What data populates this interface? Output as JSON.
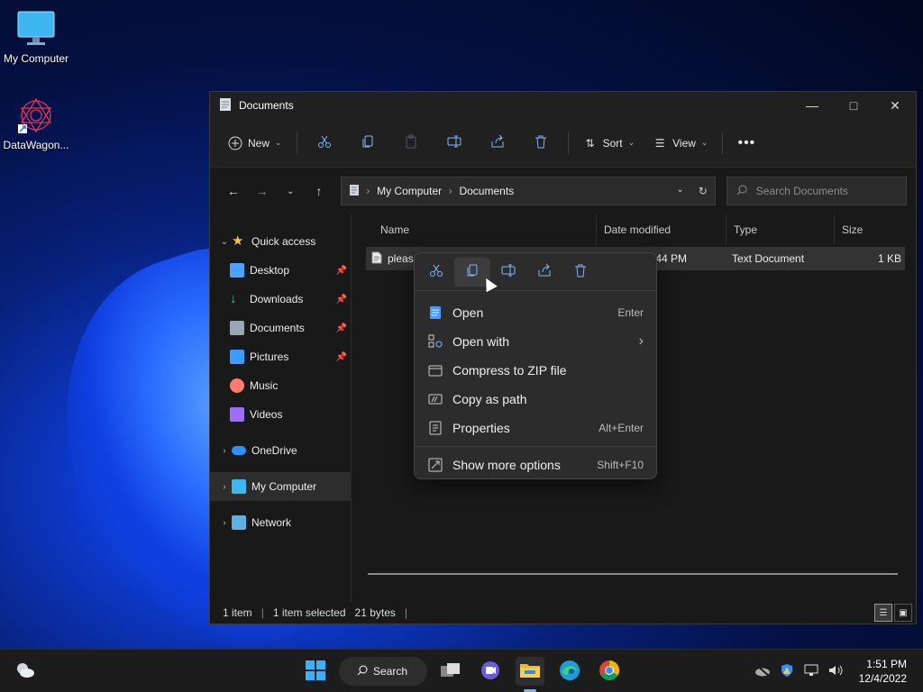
{
  "desktop": {
    "icons": [
      {
        "label": "My Computer"
      },
      {
        "label": "DataWagon..."
      }
    ]
  },
  "window": {
    "title": "Documents",
    "toolbar": {
      "new_label": "New",
      "sort_label": "Sort",
      "view_label": "View"
    },
    "address": {
      "crumbs": [
        "My Computer",
        "Documents"
      ]
    },
    "search": {
      "placeholder": "Search Documents"
    },
    "sidebar": {
      "quick_access": "Quick access",
      "items": [
        {
          "label": "Desktop",
          "color": "#4aa3ff"
        },
        {
          "label": "Downloads",
          "color": "#3ec46d"
        },
        {
          "label": "Documents",
          "color": "#9aa7b8"
        },
        {
          "label": "Pictures",
          "color": "#3b9bff"
        },
        {
          "label": "Music",
          "color": "#ff7b6e"
        },
        {
          "label": "Videos",
          "color": "#a06bff"
        }
      ],
      "onedrive": "OneDrive",
      "my_computer": "My Computer",
      "network": "Network"
    },
    "columns": {
      "name": "Name",
      "date": "Date modified",
      "type": "Type",
      "size": "Size"
    },
    "file": {
      "name": "please",
      "date": ":44 PM",
      "type": "Text Document",
      "size": "1 KB"
    },
    "status": {
      "count": "1 item",
      "selected": "1 item selected",
      "bytes": "21 bytes"
    }
  },
  "context_menu": {
    "items": [
      {
        "label": "Open",
        "shortcut": "Enter"
      },
      {
        "label": "Open with",
        "shortcut": ""
      },
      {
        "label": "Compress to ZIP file",
        "shortcut": ""
      },
      {
        "label": "Copy as path",
        "shortcut": ""
      },
      {
        "label": "Properties",
        "shortcut": "Alt+Enter"
      },
      {
        "label": "Show more options",
        "shortcut": "Shift+F10"
      }
    ]
  },
  "taskbar": {
    "search_label": "Search",
    "time": "1:51 PM",
    "date": "12/4/2022"
  },
  "colors": {
    "accent": "#7fb7ff",
    "window_bg": "#191919",
    "menu_bg": "#2c2c2c"
  }
}
